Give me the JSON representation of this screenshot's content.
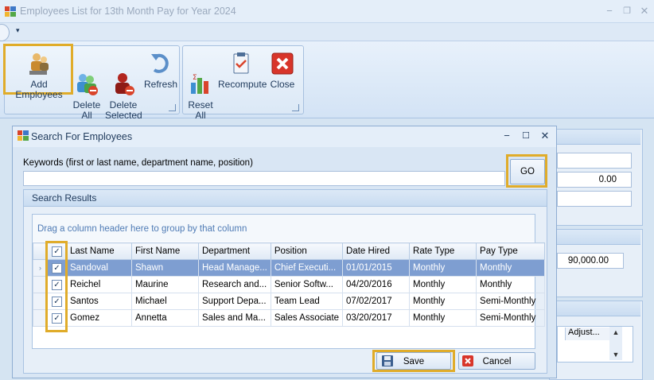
{
  "window": {
    "title": "Employees List for 13th Month Pay for Year 2024",
    "minimize": "−",
    "restore": "❐",
    "close": "✕"
  },
  "qat": {
    "arrow": "▾"
  },
  "ribbon": {
    "group1": [
      {
        "label": "Add Employees",
        "icon": "add-employees-icon"
      },
      {
        "label": "Delete\nAll",
        "icon": "delete-all-icon"
      },
      {
        "label": "Delete\nSelected",
        "icon": "delete-selected-icon"
      },
      {
        "label": "Refresh",
        "icon": "refresh-icon"
      }
    ],
    "group2": [
      {
        "label": "Reset\nAll",
        "icon": "reset-all-icon"
      },
      {
        "label": "Recompute",
        "icon": "recompute-icon"
      },
      {
        "label": "Close",
        "icon": "close-icon"
      }
    ]
  },
  "background": {
    "spin1": "0.00",
    "spin2": "90,000.00",
    "col_adjust": "Adjust..."
  },
  "dialog": {
    "title": "Search For Employees",
    "minimize": "−",
    "maximize": "☐",
    "close": "✕",
    "keywords_label": "Keywords (first or last name, department name, position)",
    "keywords_value": "",
    "go_label": "GO",
    "results_title": "Search Results",
    "group_hint": "Drag a column header here to group by that column",
    "save_label": "Save",
    "cancel_label": "Cancel"
  },
  "grid": {
    "columns": [
      "Last Name",
      "First Name",
      "Department",
      "Position",
      "Date Hired",
      "Rate Type",
      "Pay Type"
    ],
    "rows": [
      {
        "checked": true,
        "selected": true,
        "cells": [
          "Sandoval",
          "Shawn",
          "Head Manage...",
          "Chief Executi...",
          "01/01/2015",
          "Monthly",
          "Monthly"
        ]
      },
      {
        "checked": true,
        "selected": false,
        "cells": [
          "Reichel",
          "Maurine",
          "Research and...",
          "Senior Softw...",
          "04/20/2016",
          "Monthly",
          "Monthly"
        ]
      },
      {
        "checked": true,
        "selected": false,
        "cells": [
          "Santos",
          "Michael",
          "Support Depa...",
          "Team Lead",
          "07/02/2017",
          "Monthly",
          "Semi-Monthly"
        ]
      },
      {
        "checked": true,
        "selected": false,
        "cells": [
          "Gomez",
          "Annetta",
          "Sales and Ma...",
          "Sales Associate",
          "03/20/2017",
          "Monthly",
          "Semi-Monthly"
        ]
      }
    ]
  },
  "colors": {
    "highlight": "#e0ac2a",
    "selected_row": "#7e9ed1",
    "accent": "#1e395b"
  }
}
